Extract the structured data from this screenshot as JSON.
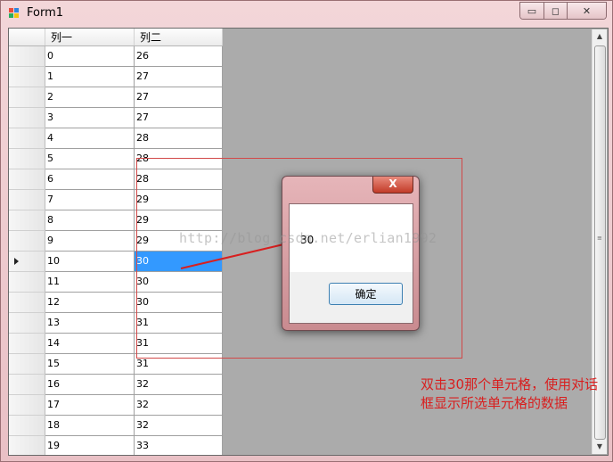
{
  "window": {
    "title": "Form1",
    "controls": {
      "minimize": "▭",
      "maximize": "◻",
      "close": "✕"
    }
  },
  "grid": {
    "columns": [
      "列一",
      "列二"
    ],
    "rows": [
      [
        "0",
        "26"
      ],
      [
        "1",
        "27"
      ],
      [
        "2",
        "27"
      ],
      [
        "3",
        "27"
      ],
      [
        "4",
        "28"
      ],
      [
        "5",
        "28"
      ],
      [
        "6",
        "28"
      ],
      [
        "7",
        "29"
      ],
      [
        "8",
        "29"
      ],
      [
        "9",
        "29"
      ],
      [
        "10",
        "30"
      ],
      [
        "11",
        "30"
      ],
      [
        "12",
        "30"
      ],
      [
        "13",
        "31"
      ],
      [
        "14",
        "31"
      ],
      [
        "15",
        "31"
      ],
      [
        "16",
        "32"
      ],
      [
        "17",
        "32"
      ],
      [
        "18",
        "32"
      ],
      [
        "19",
        "33"
      ]
    ],
    "selected_row": 10,
    "scroll_up": "▲",
    "scroll_down": "▼"
  },
  "dialog": {
    "message": "30",
    "ok_label": "确定",
    "close_glyph": "X"
  },
  "watermark": "http://blog.csdn.net/erlian1992",
  "annotation": {
    "text": "双击30那个单元格，使用对话框显示所选单元格的数据"
  },
  "colors": {
    "selection": "#3399ff",
    "annotation": "#d81f1f",
    "grid_background": "#ababab"
  }
}
